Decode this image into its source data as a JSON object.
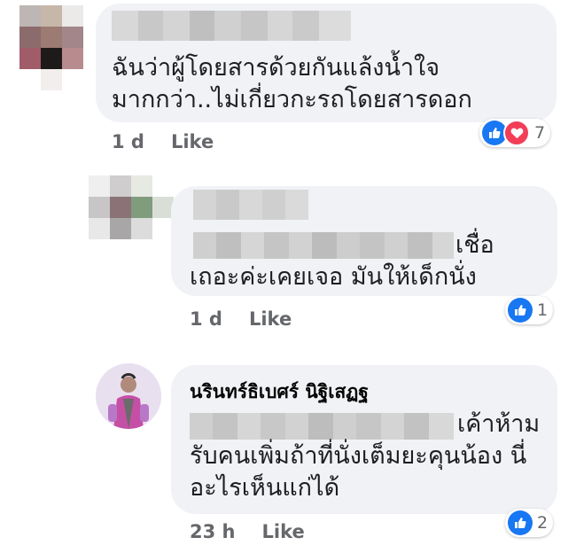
{
  "comments": [
    {
      "text_lines": [
        "ฉันว่าผู้โดยสารด้วยกันแล้งน้ำใจ",
        "มากกว่า..ไม่เกี่ยวกะรถโดยสารดอก"
      ],
      "time": "1 d",
      "like_label": "Like",
      "reaction_count": "7",
      "reactions": [
        "like-icon",
        "love-icon"
      ]
    },
    {
      "text_lines": [
        "เชื่อ",
        "เถอะค่ะเคยเจอ มันให้เด็กนั่ง"
      ],
      "time": "1 d",
      "like_label": "Like",
      "reaction_count": "1",
      "reactions": [
        "like-icon"
      ]
    },
    {
      "author": "นรินทร์ธิเบศร์ นิฐิเสฏฐ",
      "text_lines": [
        "เค้าห้าม",
        "รับคนเพิ่มถ้าที่นั่งเต็มยะคุนน้อง นี่",
        "อะไรเห็นแก่ได้"
      ],
      "time": "23 h",
      "like_label": "Like",
      "reaction_count": "2",
      "reactions": [
        "like-icon"
      ]
    }
  ],
  "colors": {
    "bubble": "#f0f2f5",
    "meta": "#65676b",
    "like_blue": "#1877f2",
    "love_red": "#f33e58"
  }
}
